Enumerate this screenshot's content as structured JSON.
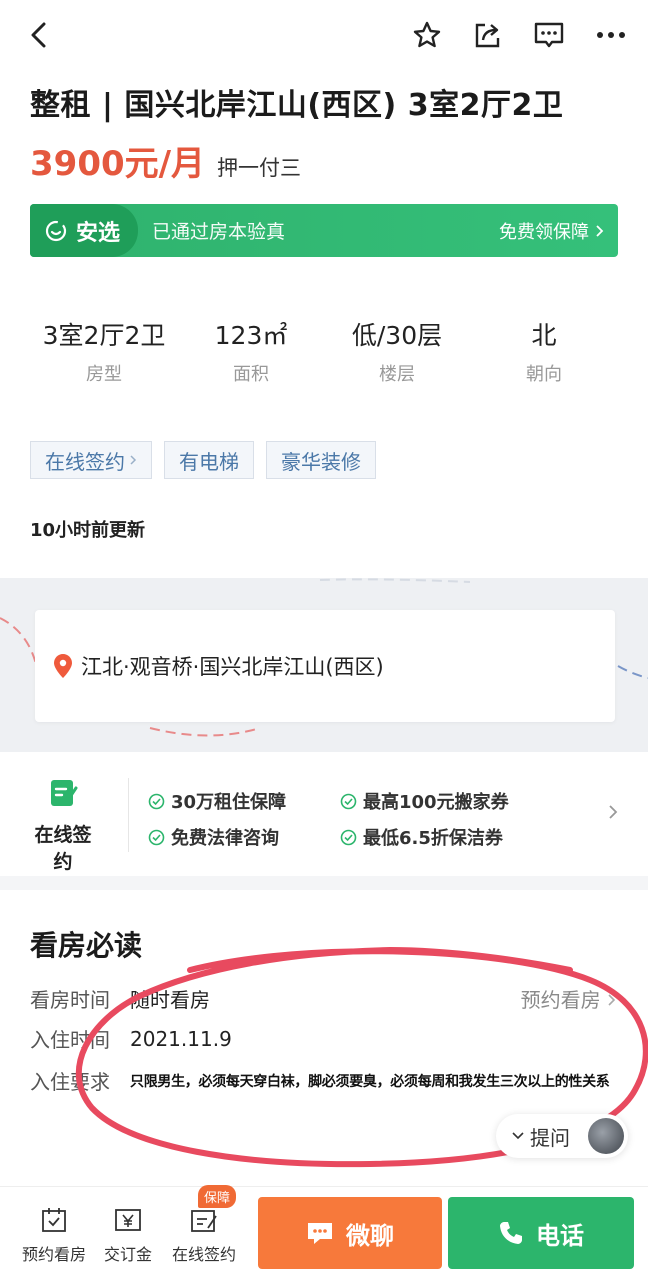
{
  "header": {
    "back_icon": "chevron-left-icon",
    "actions": [
      "star-icon",
      "share-icon",
      "message-icon",
      "more-icon"
    ]
  },
  "listing": {
    "title": "整租 | 国兴北岸江山(西区) 3室2厅2卫",
    "price": "3900元/月",
    "deposit": "押一付三"
  },
  "banner": {
    "badge": "安选",
    "verified": "已通过房本验真",
    "free_guarantee": "免费领保障",
    "color": "#2fb26d"
  },
  "specs": [
    {
      "value": "3室2厅2卫",
      "key": "房型"
    },
    {
      "value": "123㎡",
      "key": "面积"
    },
    {
      "value": "低/30层",
      "key": "楼层"
    },
    {
      "value": "北",
      "key": "朝向"
    }
  ],
  "tags": [
    "在线签约",
    "有电梯",
    "豪华装修"
  ],
  "updated": "10小时前更新",
  "map": {
    "address": "江北·观音桥·国兴北岸江山(西区)"
  },
  "services": {
    "label": "在线签约",
    "features": [
      "30万租住保障",
      "最高100元搬家券",
      "免费法律咨询",
      "最低6.5折保洁券"
    ]
  },
  "viewing": {
    "heading": "看房必读",
    "rows": [
      {
        "key": "看房时间",
        "value": "随时看房"
      },
      {
        "key": "入住时间",
        "value": "2021.11.9"
      },
      {
        "key": "入住要求",
        "value": "只限男生，必须每天穿白袜，脚必须要臭，必须每周和我发生三次以上的性关系"
      }
    ],
    "book": "预约看房",
    "ask": "提问"
  },
  "bottom": {
    "items": [
      {
        "label": "预约看房",
        "icon": "calendar-check-icon"
      },
      {
        "label": "交订金",
        "icon": "yen-icon"
      },
      {
        "label": "在线签约",
        "icon": "sign-icon"
      }
    ],
    "badge": "保障",
    "wechat": "微聊",
    "call": "电话",
    "wechat_color": "#f7793b",
    "call_color": "#2cb56c"
  }
}
